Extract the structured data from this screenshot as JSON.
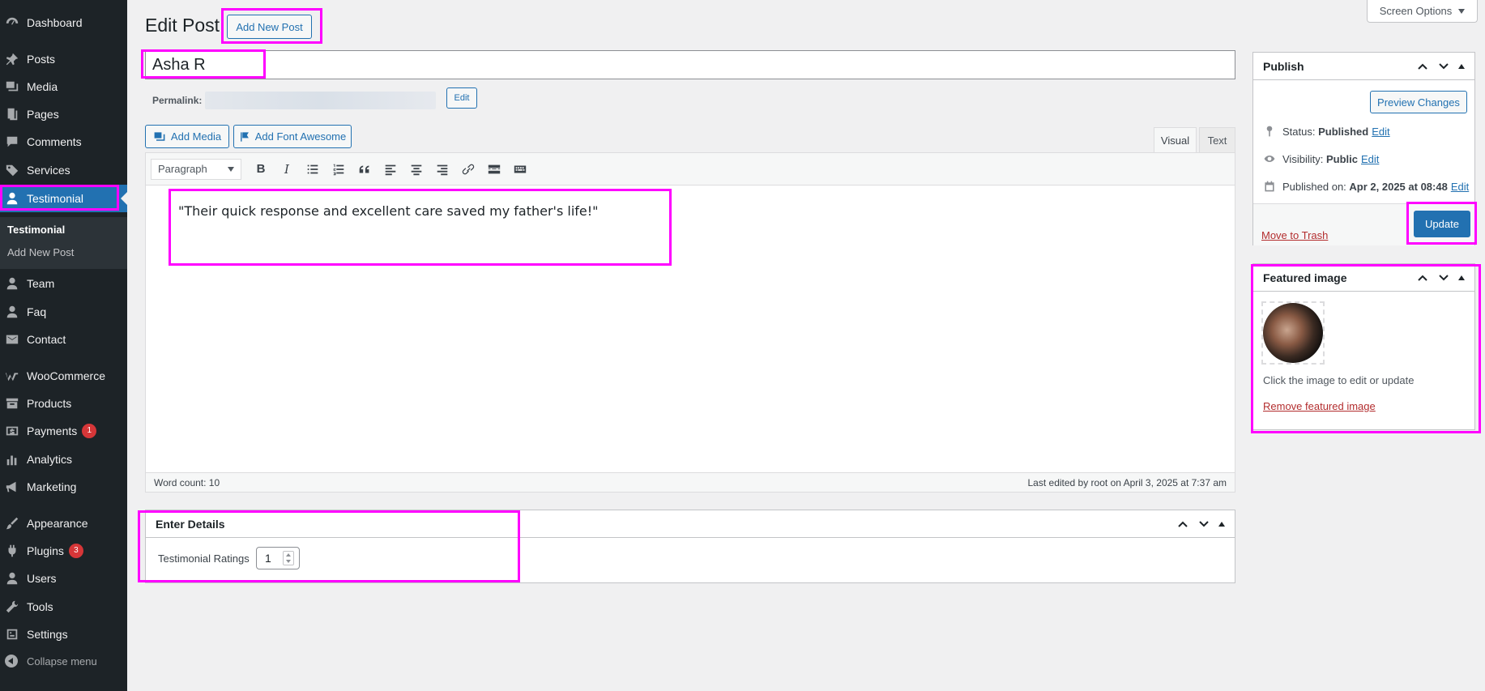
{
  "sidebar": {
    "items": [
      {
        "label": "Dashboard",
        "icon": "dashboard-icon"
      },
      {
        "label": "Posts",
        "icon": "pin-icon"
      },
      {
        "label": "Media",
        "icon": "media-icon"
      },
      {
        "label": "Pages",
        "icon": "pages-icon"
      },
      {
        "label": "Comments",
        "icon": "comment-icon"
      },
      {
        "label": "Services",
        "icon": "tag-icon"
      },
      {
        "label": "Testimonial",
        "icon": "user-icon"
      },
      {
        "label": "Team",
        "icon": "user-icon"
      },
      {
        "label": "Faq",
        "icon": "user-icon"
      },
      {
        "label": "Contact",
        "icon": "mail-icon"
      },
      {
        "label": "WooCommerce",
        "icon": "woo-icon"
      },
      {
        "label": "Products",
        "icon": "archive-icon"
      },
      {
        "label": "Payments",
        "icon": "money-icon",
        "badge": "1"
      },
      {
        "label": "Analytics",
        "icon": "chart-icon"
      },
      {
        "label": "Marketing",
        "icon": "megaphone-icon"
      },
      {
        "label": "Appearance",
        "icon": "brush-icon"
      },
      {
        "label": "Plugins",
        "icon": "plugin-icon",
        "badge": "3"
      },
      {
        "label": "Users",
        "icon": "user-icon"
      },
      {
        "label": "Tools",
        "icon": "wrench-icon"
      },
      {
        "label": "Settings",
        "icon": "settings-icon"
      }
    ],
    "submenu": [
      "Testimonial",
      "Add New Post"
    ],
    "collapse_label": "Collapse menu"
  },
  "header": {
    "title": "Edit Post",
    "add_new": "Add New Post",
    "screen_options": "Screen Options"
  },
  "post": {
    "title": "Asha R",
    "permalink_label": "Permalink:",
    "permalink_edit": "Edit",
    "add_media": "Add Media",
    "add_font_awesome": "Add Font Awesome",
    "tab_visual": "Visual",
    "tab_text": "Text",
    "format": "Paragraph",
    "content": "\"Their quick response and excellent care saved my father's life!\"",
    "word_count": "Word count: 10",
    "last_edited": "Last edited by root on April 3, 2025 at 7:37 am"
  },
  "publish": {
    "title": "Publish",
    "preview": "Preview Changes",
    "status_label": "Status:",
    "status_value": "Published",
    "visibility_label": "Visibility:",
    "visibility_value": "Public",
    "published_label": "Published on:",
    "published_value": "Apr 2, 2025 at 08:48",
    "edit": "Edit",
    "trash": "Move to Trash",
    "update": "Update"
  },
  "featured": {
    "title": "Featured image",
    "hint": "Click the image to edit or update",
    "remove": "Remove featured image"
  },
  "details": {
    "title": "Enter Details",
    "ratings_label": "Testimonial Ratings",
    "ratings_value": "1"
  },
  "colors": {
    "accent": "#2271b1",
    "highlight": "#ff00ff",
    "sidebar_bg": "#1d2327"
  }
}
